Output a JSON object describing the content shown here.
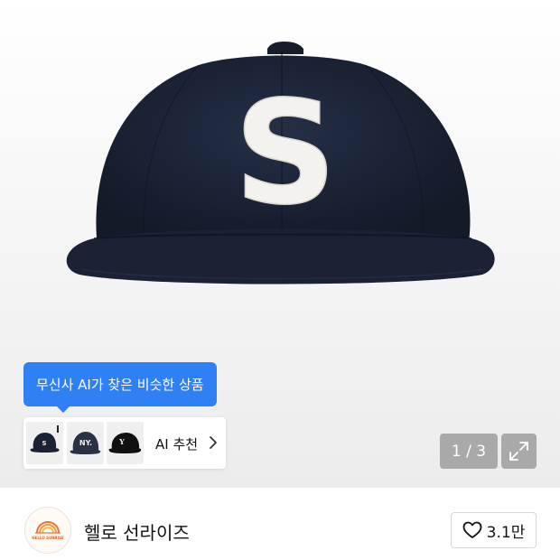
{
  "product_image": {
    "subject": "navy baseball cap with white S patch",
    "cap_letter": "S",
    "cap_color": "#1a2233",
    "patch_color": "#f4f2ee"
  },
  "ai_similar": {
    "tooltip": "무신사 AI가 찾은 비슷한 상품",
    "button_label": "AI 추천",
    "thumbnails": [
      {
        "name": "navy-cap-thumb"
      },
      {
        "name": "ny-cap-thumb",
        "letter": "NY."
      },
      {
        "name": "y-cap-thumb",
        "letter": "Y"
      }
    ],
    "chevron_icon": "chevron-right-icon",
    "accent": "#2f80f5"
  },
  "gallery": {
    "counter": "1 / 3",
    "expand_icon": "expand-icon"
  },
  "store": {
    "name": "헬로 선라이즈",
    "logo_text": "HELLO SUNRISE",
    "logo_icon": "sunrise-logo-icon",
    "like_icon": "heart-icon",
    "like_count": "3.1만"
  }
}
